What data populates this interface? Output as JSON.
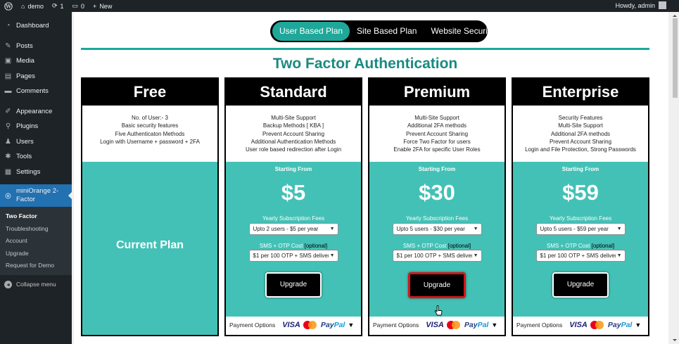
{
  "admin_bar": {
    "site_name": "demo",
    "updates_count": "1",
    "comments_count": "0",
    "new_label": "New",
    "greeting": "Howdy, admin"
  },
  "sidebar": {
    "items": [
      {
        "label": "Dashboard",
        "icon": "dashboard-icon"
      },
      {
        "label": "Posts",
        "icon": "pin-icon"
      },
      {
        "label": "Media",
        "icon": "media-icon"
      },
      {
        "label": "Pages",
        "icon": "pages-icon"
      },
      {
        "label": "Comments",
        "icon": "comments-icon"
      },
      {
        "label": "Appearance",
        "icon": "appearance-icon"
      },
      {
        "label": "Plugins",
        "icon": "plugins-icon"
      },
      {
        "label": "Users",
        "icon": "users-icon"
      },
      {
        "label": "Tools",
        "icon": "tools-icon"
      },
      {
        "label": "Settings",
        "icon": "settings-icon"
      }
    ],
    "current": {
      "label_line1": "miniOrange 2-",
      "label_line2": "Factor"
    },
    "submenu": [
      "Two Factor",
      "Troubleshooting",
      "Account",
      "Upgrade",
      "Request for Demo"
    ],
    "collapse": "Collapse menu"
  },
  "tabs": [
    "User Based Plan",
    "Site Based Plan",
    "Website Security"
  ],
  "page_title": "Two Factor Authentication",
  "accent_color": "#43c1b6",
  "plans": {
    "free": {
      "name": "Free",
      "features": [
        "No. of User:- 3",
        "Basic security features",
        "Five Authenticaton Methods",
        "Login with Username + password + 2FA"
      ],
      "current_plan": "Current Plan"
    },
    "standard": {
      "name": "Standard",
      "features": [
        "Multi-Site Support",
        "Backup Methods [ KBA ]",
        "Prevent Account Sharing",
        "Additional Authentication Methods",
        "User role based redirection after Login"
      ],
      "starting": "Starting From",
      "price": "$5",
      "fees_label": "Yearly Subscription Fees",
      "fees_value": "Upto 2 users - $5 per year",
      "sms_label": "SMS + OTP Cost",
      "sms_optional": "[optional]",
      "sms_value": "$1 per 100 OTP + SMS delivery",
      "upgrade": "Upgrade"
    },
    "premium": {
      "name": "Premium",
      "features": [
        "Multi-Site Support",
        "Additional 2FA methods",
        "Prevent Account Sharing",
        "Force Two Factor for users",
        "Enable 2FA for specific User Roles"
      ],
      "starting": "Starting From",
      "price": "$30",
      "fees_label": "Yearly Subscription Fees",
      "fees_value": "Upto 5 users - $30 per year",
      "sms_label": "SMS + OTP Cost",
      "sms_optional": "[optional]",
      "sms_value": "$1 per 100 OTP + SMS delivery",
      "upgrade": "Upgrade"
    },
    "enterprise": {
      "name": "Enterprise",
      "features": [
        "Security Features",
        "Multi-Site Support",
        "Additional 2FA methods",
        "Prevent Account Sharing",
        "Login and File Protection, Strong Passwords"
      ],
      "starting": "Starting From",
      "price": "$59",
      "fees_label": "Yearly Subscription Fees",
      "fees_value": "Upto 5 users - $59 per year",
      "sms_label": "SMS + OTP Cost",
      "sms_optional": "[optional]",
      "sms_value": "$1 per 100 OTP + SMS delivery",
      "upgrade": "Upgrade"
    }
  },
  "payment": {
    "label": "Payment Options",
    "visa": "VISA",
    "paypal_a": "Pay",
    "paypal_b": "Pal"
  }
}
